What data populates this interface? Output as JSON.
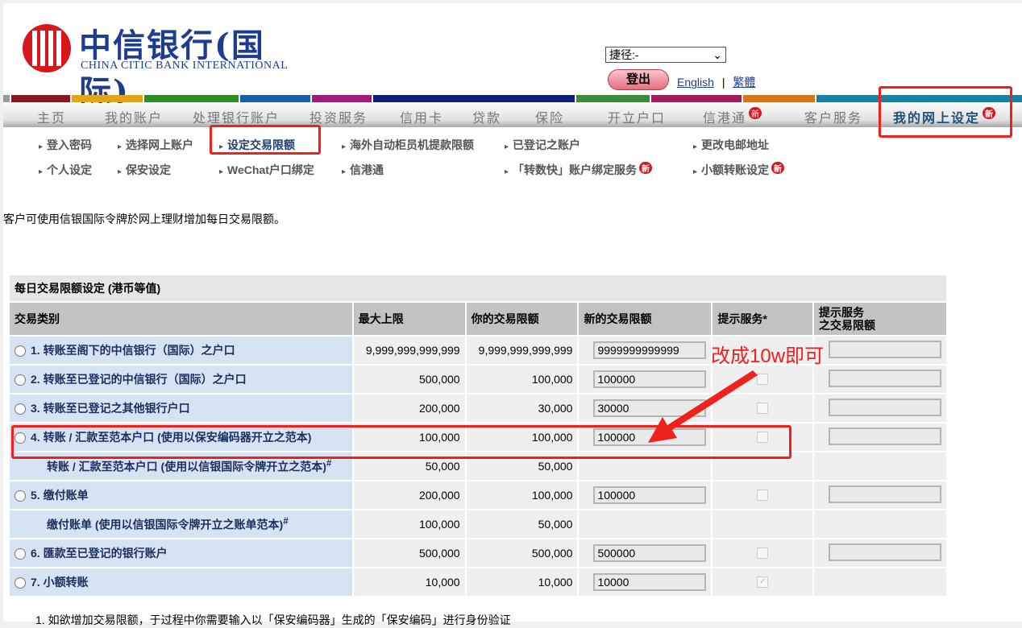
{
  "logo": {
    "cn": "中信银行(国际)",
    "en": "CHINA CITIC BANK INTERNATIONAL"
  },
  "header": {
    "shortcut": "捷径:-",
    "logout": "登出",
    "english": "English",
    "separator": "|",
    "traditional": "繁體"
  },
  "colors": {
    "bars": [
      "#999999",
      "#8a1620",
      "#e0a51a",
      "#2f8a2a",
      "#1b5fa5",
      "#a01c7a",
      "#0d1f7a",
      "#3d8a3a",
      "#a01c5a",
      "#d9741a",
      "#1e7fa0"
    ],
    "accent": "#f0201d"
  },
  "nav": [
    {
      "label": "主页"
    },
    {
      "label": "我的账户"
    },
    {
      "label": "处理银行账户"
    },
    {
      "label": "投资服务"
    },
    {
      "label": "信用卡"
    },
    {
      "label": "贷款"
    },
    {
      "label": "保险"
    },
    {
      "label": "开立户口"
    },
    {
      "label": "信港通",
      "badge": "新"
    },
    {
      "label": "客户服务"
    },
    {
      "label": "我的网上设定",
      "badge": "新"
    }
  ],
  "subnav": [
    {
      "label": "登入密码"
    },
    {
      "label": "选择网上账户"
    },
    {
      "label": "设定交易限额"
    },
    {
      "label": "海外自动柜员机提款限额"
    },
    {
      "label": "已登记之账户"
    },
    {
      "label": "更改电邮地址"
    },
    {
      "label": "个人设定"
    },
    {
      "label": "保安设定"
    },
    {
      "label": "WeChat户口绑定"
    },
    {
      "label": "信港通"
    },
    {
      "label": "「转数快」账户绑定服务",
      "badge": "新"
    },
    {
      "label": "小额转账设定",
      "badge": "新"
    }
  ],
  "intro": "客户可使用信银国际令牌於网上理财增加每日交易限额。",
  "table": {
    "title": "每日交易限额设定 (港币等值)",
    "headers": [
      "交易类别",
      "最大上限",
      "你的交易限额",
      "新的交易限额",
      "提示服务*",
      "提示服务\n之交易限额"
    ],
    "header6a": "提示服务",
    "header6b": "之交易限额",
    "rows": [
      {
        "label": "1.  转账至阁下的中信银行（国际）之户口",
        "max": "9,999,999,999,999",
        "yours": "9,999,999,999,999",
        "new": "9999999999999"
      },
      {
        "label": "2.  转账至已登记的中信银行（国际）之户口",
        "max": "500,000",
        "yours": "100,000",
        "new": "100000"
      },
      {
        "label": "3.  转账至已登记之其他银行户口",
        "max": "200,000",
        "yours": "30,000",
        "new": "30000"
      },
      {
        "label": "4.  转账 / 汇款至范本户口 (使用以保安编码器开立之范本)",
        "max": "100,000",
        "yours": "100,000",
        "new": "100000"
      },
      {
        "label": "转账 / 汇款至范本户口 (使用以信银国际令牌开立之范本)",
        "sup": "#",
        "max": "50,000",
        "yours": "50,000"
      },
      {
        "label": "5.  缴付账单",
        "max": "200,000",
        "yours": "100,000",
        "new": "100000"
      },
      {
        "label": "缴付账单 (使用以信银国际令牌开立之账单范本)",
        "sup": "#",
        "max": "100,000",
        "yours": "50,000"
      },
      {
        "label": "6.  匯款至已登记的银行账户",
        "max": "500,000",
        "yours": "500,000",
        "new": "500000"
      },
      {
        "label": "7.  小额转账",
        "max": "10,000",
        "yours": "10,000",
        "new": "10000"
      }
    ]
  },
  "annotation": "改成10w即可",
  "note": "1. 如欲增加交易限额，于过程中你需要输入以「保安编码器」生成的「保安编码」进行身份验证"
}
